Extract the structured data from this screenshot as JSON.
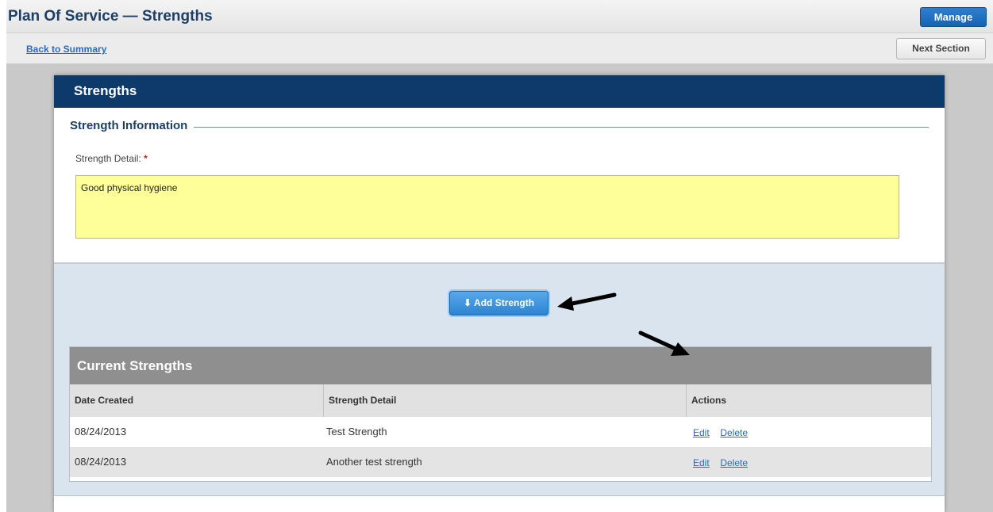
{
  "header": {
    "title": "Plan Of Service — Strengths",
    "manage_label": "Manage"
  },
  "nav": {
    "back_label": "Back to Summary",
    "next_label": "Next Section"
  },
  "panel": {
    "title": "Strengths",
    "section_title": "Strength Information",
    "field_label": "Strength Detail:",
    "required_marker": "*",
    "field_value": "Good physical hygiene",
    "add_button_label": "Add Strength"
  },
  "table": {
    "title": "Current Strengths",
    "columns": [
      "Date Created",
      "Strength Detail",
      "Actions"
    ],
    "rows": [
      {
        "date": "08/24/2013",
        "detail": "Test Strength",
        "edit": "Edit",
        "delete": "Delete"
      },
      {
        "date": "08/24/2013",
        "detail": "Another test strength",
        "edit": "Edit",
        "delete": "Delete"
      }
    ]
  },
  "colors": {
    "title_text": "#1d3f66",
    "panel_header": "#0e3a6b",
    "input_background": "#ffff9a",
    "primary_button": "#1663b4",
    "link": "#2a6ac0"
  },
  "icons": {
    "add_button_icon": "download-arrow-icon",
    "annotation": "black-arrow-icon"
  }
}
